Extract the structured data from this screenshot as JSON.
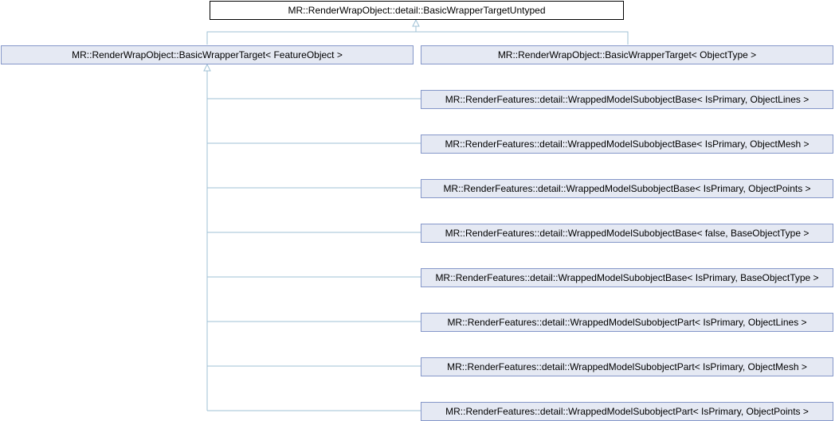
{
  "diagram": {
    "root": "MR::RenderWrapObject::detail::BasicWrapperTargetUntyped",
    "bases": [
      "MR::RenderWrapObject::BasicWrapperTarget< FeatureObject >",
      "MR::RenderWrapObject::BasicWrapperTarget< ObjectType >"
    ],
    "derived": [
      "MR::RenderFeatures::detail::WrappedModelSubobjectBase< IsPrimary, ObjectLines >",
      "MR::RenderFeatures::detail::WrappedModelSubobjectBase< IsPrimary, ObjectMesh >",
      "MR::RenderFeatures::detail::WrappedModelSubobjectBase< IsPrimary, ObjectPoints >",
      "MR::RenderFeatures::detail::WrappedModelSubobjectBase< false, BaseObjectType >",
      "MR::RenderFeatures::detail::WrappedModelSubobjectBase< IsPrimary, BaseObjectType >",
      "MR::RenderFeatures::detail::WrappedModelSubobjectPart< IsPrimary, ObjectLines >",
      "MR::RenderFeatures::detail::WrappedModelSubobjectPart< IsPrimary, ObjectMesh >",
      "MR::RenderFeatures::detail::WrappedModelSubobjectPart< IsPrimary, ObjectPoints >"
    ],
    "colors": {
      "node_fill": "#e5e9f3",
      "node_border": "#8597c9",
      "root_fill": "#ffffff",
      "root_border": "#000000",
      "edge": "#9fc1d6"
    }
  }
}
